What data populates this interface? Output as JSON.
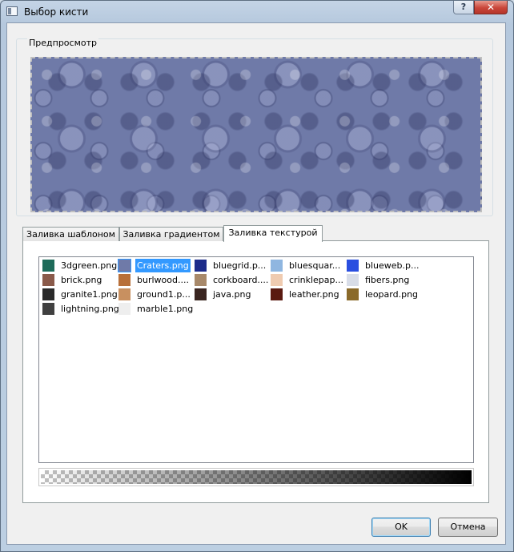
{
  "window": {
    "title": "Выбор кисти",
    "help_label": "?",
    "close_label": "✕"
  },
  "preview": {
    "label": "Предпросмотр"
  },
  "tabs": [
    {
      "label": "Заливка шаблоном",
      "active": false
    },
    {
      "label": "Заливка градиентом",
      "active": false
    },
    {
      "label": "Заливка текстурой",
      "active": true
    }
  ],
  "textures": [
    {
      "label": "3dgreen.png",
      "color": "#1e6b5a"
    },
    {
      "label": "Craters.png",
      "color": "#6f7aa8",
      "selected": true
    },
    {
      "label": "bluegrid.p...",
      "color": "#1c2b8a"
    },
    {
      "label": "bluesquar...",
      "color": "#8fb6e0"
    },
    {
      "label": "blueweb.p...",
      "color": "#2a4fe0"
    },
    {
      "label": "brick.png",
      "color": "#8a5a4a"
    },
    {
      "label": "burlwood....",
      "color": "#b8703a"
    },
    {
      "label": "corkboard....",
      "color": "#a8896a"
    },
    {
      "label": "crinklepap...",
      "color": "#efcbb0"
    },
    {
      "label": "fibers.png",
      "color": "#d8dde8"
    },
    {
      "label": "granite1.png",
      "color": "#2a2a2a"
    },
    {
      "label": "ground1.p...",
      "color": "#c89060"
    },
    {
      "label": "java.png",
      "color": "#3a2520"
    },
    {
      "label": "leather.png",
      "color": "#5a1a10"
    },
    {
      "label": "leopard.png",
      "color": "#8a6a2a"
    },
    {
      "label": "lightning.png",
      "color": "#404040"
    },
    {
      "label": "marble1.png",
      "color": "#eeeeee"
    }
  ],
  "buttons": {
    "ok": "OK",
    "cancel": "Отмена"
  }
}
